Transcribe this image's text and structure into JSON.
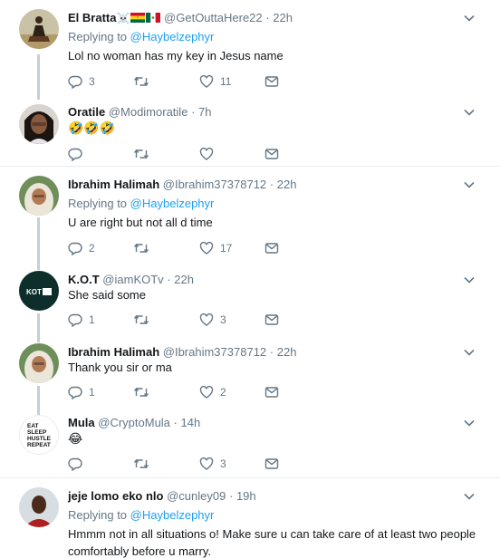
{
  "tweets": [
    {
      "name": "El Bratta",
      "name_emoji": "☠️",
      "handle": "@GetOuttaHere22",
      "time": "22h",
      "replying_label": "Replying to",
      "replying_to": "@Haybelzephyr",
      "text": "Lol no woman has my key in Jesus name",
      "replies": "3",
      "retweets": "",
      "likes": "11"
    },
    {
      "name": "Oratile",
      "handle": "@Modimoratile",
      "time": "7h",
      "text": "",
      "emoji_text": "🤣🤣🤣",
      "replies": "",
      "retweets": "",
      "likes": ""
    },
    {
      "name": "Ibrahim Halimah",
      "handle": "@Ibrahim37378712",
      "time": "22h",
      "replying_label": "Replying to",
      "replying_to": "@Haybelzephyr",
      "text": "U are right but not all d time",
      "replies": "2",
      "retweets": "",
      "likes": "17"
    },
    {
      "name": "K.O.T",
      "handle": "@iamKOTv",
      "time": "22h",
      "text": "She said some",
      "replies": "1",
      "retweets": "",
      "likes": "3"
    },
    {
      "name": "Ibrahim Halimah",
      "handle": "@Ibrahim37378712",
      "time": "22h",
      "text": "Thank you sir or ma",
      "replies": "1",
      "retweets": "",
      "likes": "2"
    },
    {
      "name": "Mula",
      "handle": "@CryptoMula",
      "time": "14h",
      "text": "",
      "emoji_text": "😂",
      "replies": "",
      "retweets": "",
      "likes": "3"
    },
    {
      "name": "jeje lomo eko nlo",
      "handle": "@cunley09",
      "time": "19h",
      "replying_label": "Replying to",
      "replying_to": "@Haybelzephyr",
      "text": "Hmmm not in all situations o! Make sure u can take care of at least two people comfortably before u marry.",
      "replies": "",
      "retweets": "",
      "likes": ""
    }
  ],
  "separator": "·",
  "colors": {
    "link": "#1da1f2",
    "muted": "#657786",
    "thread": "#c4cfd6",
    "border": "#e6ecf0"
  },
  "avatar_text": {
    "kot": "KOT",
    "mula": [
      "EAT",
      "SLEEP",
      "HUSTLE",
      "REPEAT"
    ]
  }
}
